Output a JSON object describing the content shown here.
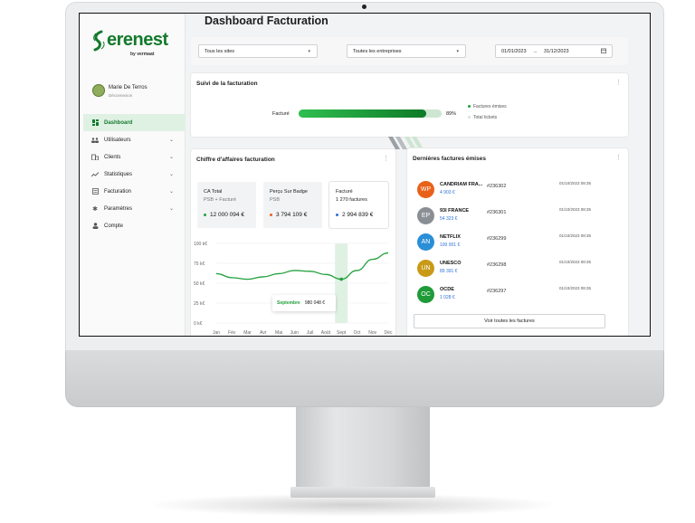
{
  "app": {
    "brand": "erenest",
    "brand_sub": "by vermaat",
    "page_title": "Dashboard Facturation"
  },
  "user": {
    "name": "Marie De Terros",
    "logout": "Déconnexion"
  },
  "sidebar": {
    "items": [
      {
        "label": "Dashboard",
        "icon": "dashboard-icon",
        "active": true
      },
      {
        "label": "Utilisateurs",
        "icon": "users-icon",
        "chevron": true
      },
      {
        "label": "Clients",
        "icon": "clients-icon",
        "chevron": true
      },
      {
        "label": "Statistiques",
        "icon": "stats-icon",
        "chevron": true
      },
      {
        "label": "Facturation",
        "icon": "invoice-icon",
        "chevron": true
      },
      {
        "label": "Paramètres",
        "icon": "gear-icon",
        "chevron": true
      },
      {
        "label": "Compte",
        "icon": "account-icon"
      }
    ]
  },
  "filters": {
    "sites": "Tous les sites",
    "entreprises": "Toutes les entreprises",
    "date_from": "01/01/2023",
    "date_arrow": "→",
    "date_to": "31/12/2023"
  },
  "suivi": {
    "title": "Suivi de la facturation",
    "bar_label": "Facturé",
    "percent_label": "89%",
    "percent": 0.89,
    "legend": [
      {
        "label": "Factures émises",
        "color": "#22a03d"
      },
      {
        "label": "Total tickets",
        "color": "#cde6d2"
      }
    ]
  },
  "ca": {
    "title": "Chiffre d'affaires facturation",
    "kpis": [
      {
        "title": "CA Total",
        "sub": "PSB + Facturé",
        "value": "12 000 094 €",
        "color": "#22a03d"
      },
      {
        "title": "Perçu Sur Badge",
        "sub": "PSB",
        "value": "3 794 109 €",
        "color": "#e8611a"
      },
      {
        "title": "Facturé",
        "sub": "1 270 factures",
        "value": "2 994 839 €",
        "color": "#2a6fd6"
      }
    ],
    "tooltip_label": "Septembre",
    "tooltip_value": "980 048 €"
  },
  "chart_data": {
    "type": "line",
    "categories": [
      "Jan",
      "Fév",
      "Mar",
      "Avr",
      "Mai",
      "Juin",
      "Juil",
      "Août",
      "Sept",
      "Oct",
      "Nov",
      "Déc"
    ],
    "y_ticks": [
      "100 k€",
      "75 k€",
      "50 k€",
      "25 k€",
      "0 k€"
    ],
    "ylim": [
      0,
      100
    ],
    "highlight": "Sept",
    "series": [
      {
        "values": [
          62,
          57,
          55,
          58,
          62,
          66,
          65,
          61,
          55,
          66,
          80,
          88
        ]
      }
    ]
  },
  "factures": {
    "title": "Dernières factures émises",
    "see_all": "Voir toutes les factures",
    "rows": [
      {
        "initials": "WP",
        "name": "CANDRIAM FRA...",
        "amount": "4 903 €",
        "number": "#236302",
        "date": "01/10/2023 08:35",
        "color": "#e8611a"
      },
      {
        "initials": "EP",
        "name": "93I FRANCE",
        "amount": "54 323 €",
        "number": "#236301",
        "date": "01/10/2023 08:35",
        "color": "#8a8f96"
      },
      {
        "initials": "AN",
        "name": "NETFLIX",
        "amount": "100 001 €",
        "number": "#236299",
        "date": "01/10/2023 08:35",
        "color": "#2a8fd6"
      },
      {
        "initials": "UN",
        "name": "UNESCO",
        "amount": "89 391 €",
        "number": "#236298",
        "date": "01/10/2023 08:35",
        "color": "#c99a18"
      },
      {
        "initials": "OC",
        "name": "OCDE",
        "amount": "1 028 €",
        "number": "#236297",
        "date": "01/10/2023 08:35",
        "color": "#1f9a38"
      }
    ]
  }
}
